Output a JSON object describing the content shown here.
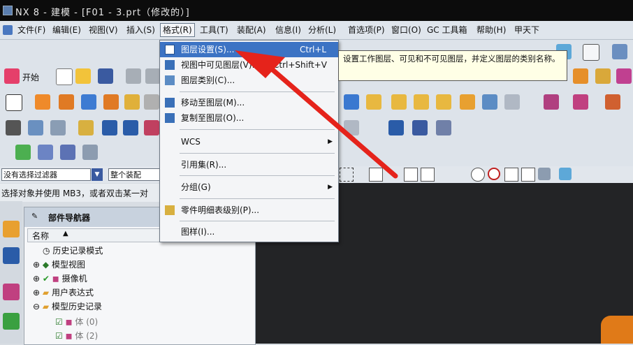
{
  "window": {
    "title": "NX 8 - 建模 - [F01 - 3.prt（修改的）]"
  },
  "menubar": {
    "items": [
      {
        "label": "文件(F)"
      },
      {
        "label": "编辑(E)"
      },
      {
        "label": "视图(V)"
      },
      {
        "label": "插入(S)"
      },
      {
        "label": "格式(R)"
      },
      {
        "label": "工具(T)"
      },
      {
        "label": "装配(A)"
      },
      {
        "label": "信息(I)"
      },
      {
        "label": "分析(L)"
      },
      {
        "label": "首选项(P)"
      },
      {
        "label": "窗口(O)"
      },
      {
        "label": "GC 工具箱"
      },
      {
        "label": "帮助(H)"
      },
      {
        "label": "甲天下"
      }
    ]
  },
  "toolbar": {
    "start_label": "开始"
  },
  "dropdown": {
    "items": [
      {
        "label": "图层设置(S)...",
        "shortcut": "Ctrl+L",
        "icon": "layer-settings-icon"
      },
      {
        "label": "视图中可见图层(V)...",
        "shortcut": "Ctrl+Shift+V",
        "icon": "visible-layers-icon"
      },
      {
        "label": "图层类别(C)...",
        "shortcut": "",
        "icon": "layer-category-icon"
      },
      {
        "label": "移动至图层(M)...",
        "shortcut": "",
        "icon": "move-to-layer-icon"
      },
      {
        "label": "复制至图层(O)...",
        "shortcut": "",
        "icon": "copy-to-layer-icon"
      },
      {
        "label": "WCS",
        "shortcut": "",
        "icon": ""
      },
      {
        "label": "引用集(R)...",
        "shortcut": "",
        "icon": ""
      },
      {
        "label": "分组(G)",
        "shortcut": "",
        "icon": ""
      },
      {
        "label": "零件明细表级别(P)...",
        "shortcut": "",
        "icon": "parts-list-icon"
      },
      {
        "label": "图样(I)...",
        "shortcut": "",
        "icon": ""
      }
    ]
  },
  "tooltip": {
    "text": "设置工作图层、可见和不可见图层，并定义图层的类别名称。"
  },
  "filterbar": {
    "filter_label": "没有选择过滤器",
    "assembly_label": "整个装配"
  },
  "statusbar": {
    "text": "选择对象并使用 MB3，或者双击某一对"
  },
  "navigator": {
    "title": "部件导航器",
    "column_name": "名称",
    "rows": [
      {
        "label": "历史记录模式"
      },
      {
        "label": "模型视图"
      },
      {
        "label": "摄像机"
      },
      {
        "label": "用户表达式"
      },
      {
        "label": "模型历史记录"
      },
      {
        "label": "体 (0)"
      },
      {
        "label": "体 (2)"
      }
    ]
  },
  "colors": {
    "arrow": "#e5231b",
    "highlight": "#3c73c4",
    "canvas": "#232426"
  }
}
